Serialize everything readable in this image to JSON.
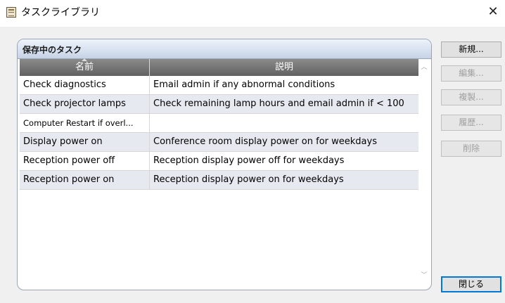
{
  "window": {
    "title": "タスクライブラリ",
    "close_glyph": "✕"
  },
  "group": {
    "title": "保存中のタスク"
  },
  "table": {
    "columns": [
      "名前",
      "説明"
    ],
    "rows": [
      {
        "name": "Check diagnostics",
        "description": "Email admin if any abnormal conditions"
      },
      {
        "name": "Check projector lamps",
        "description": "Check remaining lamp hours and email admin if < 100"
      },
      {
        "name": "Computer Restart if overl...",
        "description": ""
      },
      {
        "name": "Display power on",
        "description": "Conference room display power on for weekdays"
      },
      {
        "name": "Reception power off",
        "description": "Reception display power off for weekdays"
      },
      {
        "name": "Reception power on",
        "description": "Reception display power on for weekdays"
      }
    ]
  },
  "buttons": {
    "new": "新規...",
    "edit": "編集...",
    "duplicate": "複製...",
    "history": "履歴...",
    "delete": "削除",
    "close": "閉じる"
  },
  "icons": {
    "scroll_up": "︿",
    "scroll_down": "﹀"
  }
}
